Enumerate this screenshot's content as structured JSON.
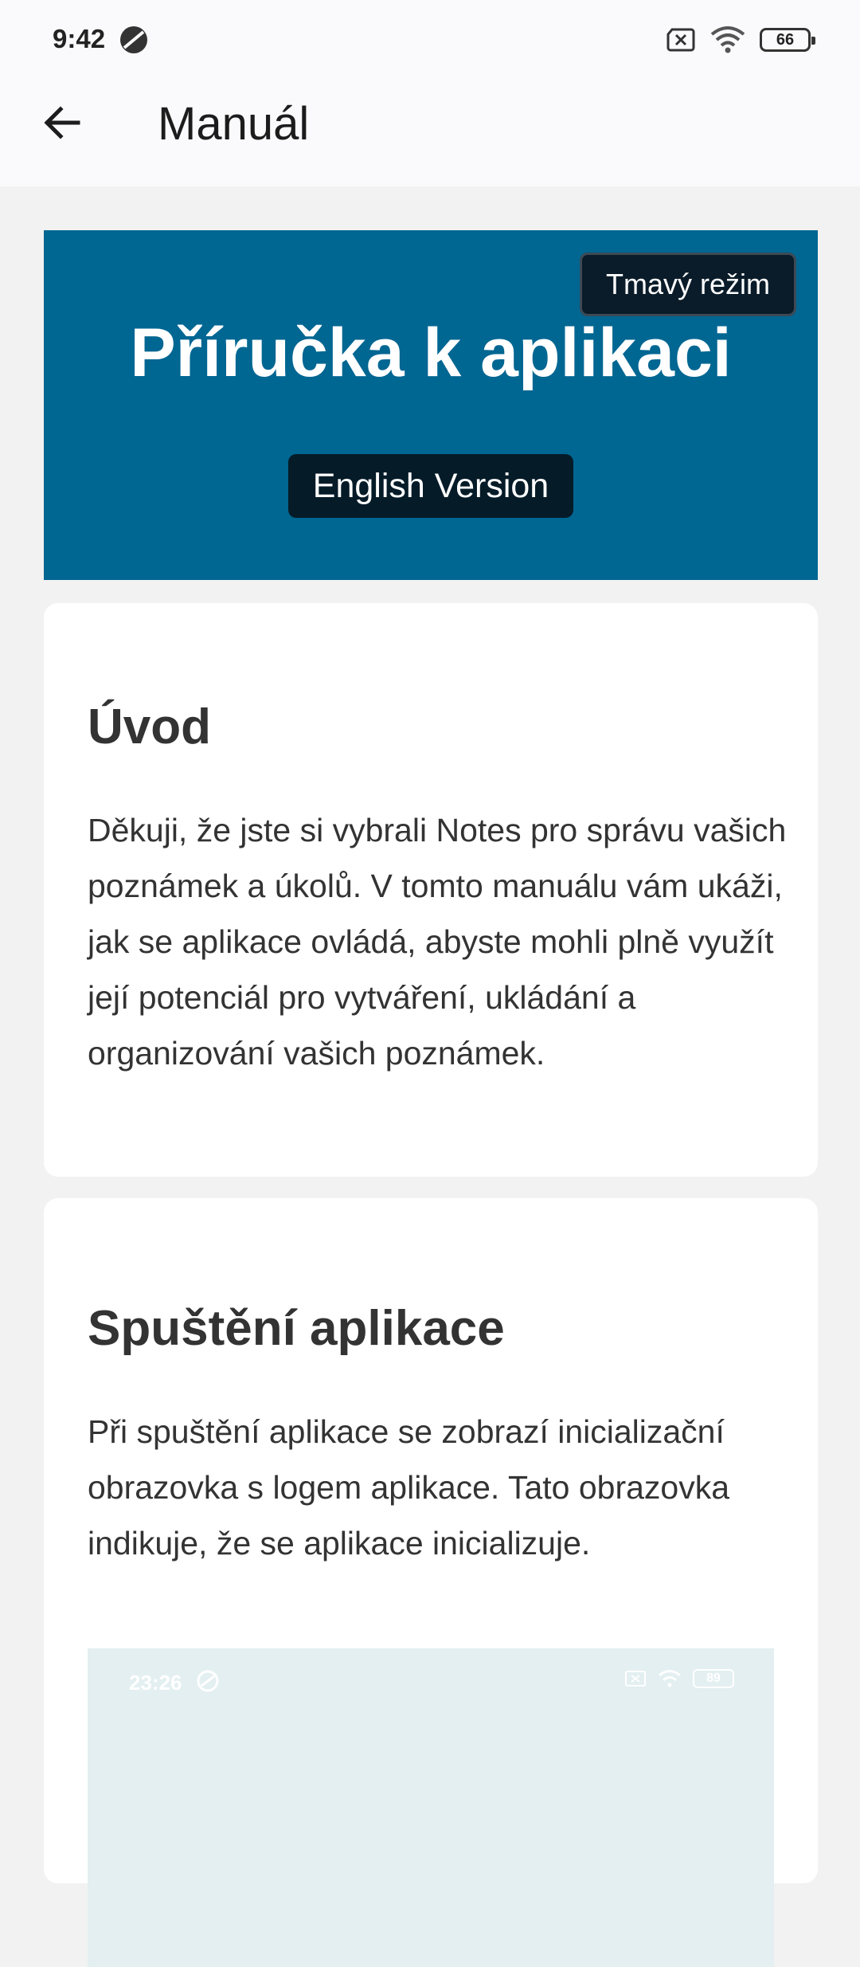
{
  "status_bar": {
    "time": "9:42",
    "battery": "66"
  },
  "app_bar": {
    "title": "Manuál"
  },
  "hero": {
    "dark_mode_label": "Tmavý režim",
    "title": "Příručka k aplikaci",
    "english_label": "English Version",
    "background": "#006692"
  },
  "sections": [
    {
      "heading": "Úvod",
      "text": "Děkuji, že jste si vybrali Notes pro správu vašich poznámek a úkolů. V tomto manuálu vám ukáži, jak se aplikace ovládá, abyste mohli plně využít její potenciál pro vytváření, ukládání a organizování vašich poznámek."
    },
    {
      "heading": "Spuštění aplikace",
      "text": "Při spuštění aplikace se zobrazí inicializační obrazovka s logem aplikace. Tato obrazovka indikuje, že se aplikace inicializuje."
    }
  ],
  "preview": {
    "time": "23:26",
    "battery": "89"
  }
}
